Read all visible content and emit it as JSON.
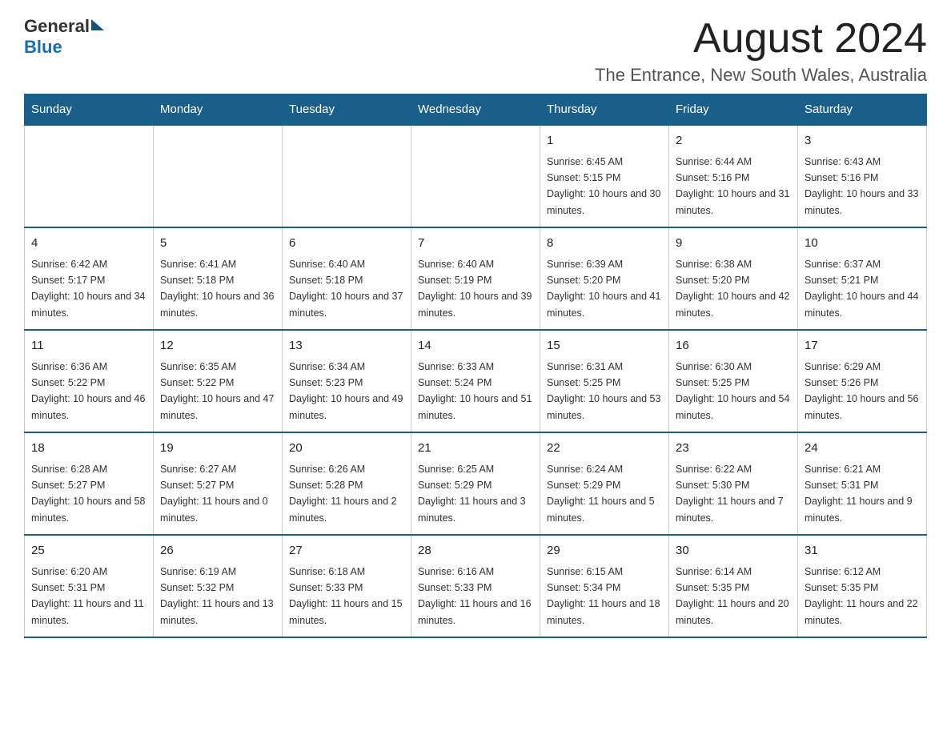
{
  "header": {
    "logo_general": "General",
    "logo_blue": "Blue",
    "month_title": "August 2024",
    "location": "The Entrance, New South Wales, Australia"
  },
  "days_of_week": [
    "Sunday",
    "Monday",
    "Tuesday",
    "Wednesday",
    "Thursday",
    "Friday",
    "Saturday"
  ],
  "weeks": [
    [
      {
        "day": "",
        "info": ""
      },
      {
        "day": "",
        "info": ""
      },
      {
        "day": "",
        "info": ""
      },
      {
        "day": "",
        "info": ""
      },
      {
        "day": "1",
        "info": "Sunrise: 6:45 AM\nSunset: 5:15 PM\nDaylight: 10 hours and 30 minutes."
      },
      {
        "day": "2",
        "info": "Sunrise: 6:44 AM\nSunset: 5:16 PM\nDaylight: 10 hours and 31 minutes."
      },
      {
        "day": "3",
        "info": "Sunrise: 6:43 AM\nSunset: 5:16 PM\nDaylight: 10 hours and 33 minutes."
      }
    ],
    [
      {
        "day": "4",
        "info": "Sunrise: 6:42 AM\nSunset: 5:17 PM\nDaylight: 10 hours and 34 minutes."
      },
      {
        "day": "5",
        "info": "Sunrise: 6:41 AM\nSunset: 5:18 PM\nDaylight: 10 hours and 36 minutes."
      },
      {
        "day": "6",
        "info": "Sunrise: 6:40 AM\nSunset: 5:18 PM\nDaylight: 10 hours and 37 minutes."
      },
      {
        "day": "7",
        "info": "Sunrise: 6:40 AM\nSunset: 5:19 PM\nDaylight: 10 hours and 39 minutes."
      },
      {
        "day": "8",
        "info": "Sunrise: 6:39 AM\nSunset: 5:20 PM\nDaylight: 10 hours and 41 minutes."
      },
      {
        "day": "9",
        "info": "Sunrise: 6:38 AM\nSunset: 5:20 PM\nDaylight: 10 hours and 42 minutes."
      },
      {
        "day": "10",
        "info": "Sunrise: 6:37 AM\nSunset: 5:21 PM\nDaylight: 10 hours and 44 minutes."
      }
    ],
    [
      {
        "day": "11",
        "info": "Sunrise: 6:36 AM\nSunset: 5:22 PM\nDaylight: 10 hours and 46 minutes."
      },
      {
        "day": "12",
        "info": "Sunrise: 6:35 AM\nSunset: 5:22 PM\nDaylight: 10 hours and 47 minutes."
      },
      {
        "day": "13",
        "info": "Sunrise: 6:34 AM\nSunset: 5:23 PM\nDaylight: 10 hours and 49 minutes."
      },
      {
        "day": "14",
        "info": "Sunrise: 6:33 AM\nSunset: 5:24 PM\nDaylight: 10 hours and 51 minutes."
      },
      {
        "day": "15",
        "info": "Sunrise: 6:31 AM\nSunset: 5:25 PM\nDaylight: 10 hours and 53 minutes."
      },
      {
        "day": "16",
        "info": "Sunrise: 6:30 AM\nSunset: 5:25 PM\nDaylight: 10 hours and 54 minutes."
      },
      {
        "day": "17",
        "info": "Sunrise: 6:29 AM\nSunset: 5:26 PM\nDaylight: 10 hours and 56 minutes."
      }
    ],
    [
      {
        "day": "18",
        "info": "Sunrise: 6:28 AM\nSunset: 5:27 PM\nDaylight: 10 hours and 58 minutes."
      },
      {
        "day": "19",
        "info": "Sunrise: 6:27 AM\nSunset: 5:27 PM\nDaylight: 11 hours and 0 minutes."
      },
      {
        "day": "20",
        "info": "Sunrise: 6:26 AM\nSunset: 5:28 PM\nDaylight: 11 hours and 2 minutes."
      },
      {
        "day": "21",
        "info": "Sunrise: 6:25 AM\nSunset: 5:29 PM\nDaylight: 11 hours and 3 minutes."
      },
      {
        "day": "22",
        "info": "Sunrise: 6:24 AM\nSunset: 5:29 PM\nDaylight: 11 hours and 5 minutes."
      },
      {
        "day": "23",
        "info": "Sunrise: 6:22 AM\nSunset: 5:30 PM\nDaylight: 11 hours and 7 minutes."
      },
      {
        "day": "24",
        "info": "Sunrise: 6:21 AM\nSunset: 5:31 PM\nDaylight: 11 hours and 9 minutes."
      }
    ],
    [
      {
        "day": "25",
        "info": "Sunrise: 6:20 AM\nSunset: 5:31 PM\nDaylight: 11 hours and 11 minutes."
      },
      {
        "day": "26",
        "info": "Sunrise: 6:19 AM\nSunset: 5:32 PM\nDaylight: 11 hours and 13 minutes."
      },
      {
        "day": "27",
        "info": "Sunrise: 6:18 AM\nSunset: 5:33 PM\nDaylight: 11 hours and 15 minutes."
      },
      {
        "day": "28",
        "info": "Sunrise: 6:16 AM\nSunset: 5:33 PM\nDaylight: 11 hours and 16 minutes."
      },
      {
        "day": "29",
        "info": "Sunrise: 6:15 AM\nSunset: 5:34 PM\nDaylight: 11 hours and 18 minutes."
      },
      {
        "day": "30",
        "info": "Sunrise: 6:14 AM\nSunset: 5:35 PM\nDaylight: 11 hours and 20 minutes."
      },
      {
        "day": "31",
        "info": "Sunrise: 6:12 AM\nSunset: 5:35 PM\nDaylight: 11 hours and 22 minutes."
      }
    ]
  ]
}
